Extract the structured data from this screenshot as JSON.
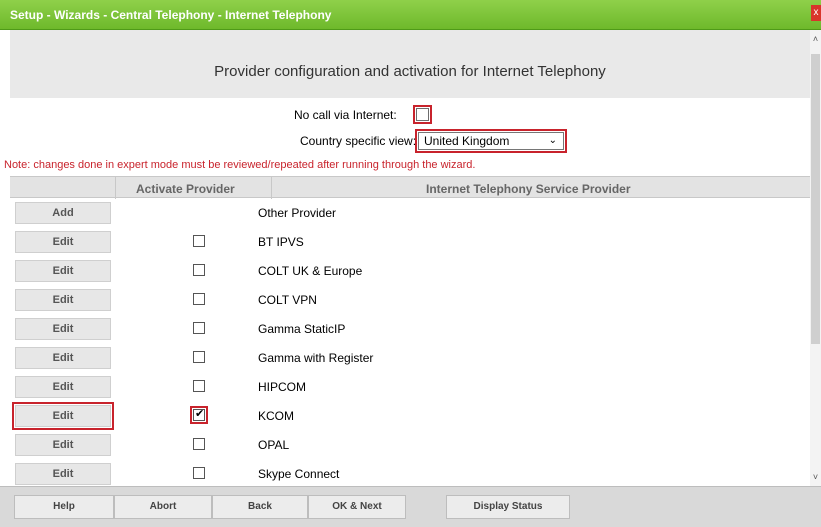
{
  "window": {
    "title": "Setup - Wizards - Central Telephony - Internet Telephony",
    "close_glyph": "x"
  },
  "header": {
    "title": "Provider configuration and activation for Internet Telephony"
  },
  "form": {
    "no_call_label": "No call via Internet:",
    "no_call_checked": false,
    "country_label": "Country specific view:",
    "country_value": "United Kingdom"
  },
  "note": "Note: changes done in expert mode must be reviewed/repeated after running through the wizard.",
  "table": {
    "headers": [
      "Activate Provider",
      "Internet Telephony Service Provider"
    ],
    "rows": [
      {
        "button": "Add",
        "has_checkbox": false,
        "checked": false,
        "name": "Other Provider"
      },
      {
        "button": "Edit",
        "has_checkbox": true,
        "checked": false,
        "name": "BT IPVS"
      },
      {
        "button": "Edit",
        "has_checkbox": true,
        "checked": false,
        "name": "COLT UK & Europe"
      },
      {
        "button": "Edit",
        "has_checkbox": true,
        "checked": false,
        "name": "COLT VPN"
      },
      {
        "button": "Edit",
        "has_checkbox": true,
        "checked": false,
        "name": "Gamma StaticIP"
      },
      {
        "button": "Edit",
        "has_checkbox": true,
        "checked": false,
        "name": "Gamma with Register"
      },
      {
        "button": "Edit",
        "has_checkbox": true,
        "checked": false,
        "name": "HIPCOM"
      },
      {
        "button": "Edit",
        "has_checkbox": true,
        "checked": true,
        "name": "KCOM"
      },
      {
        "button": "Edit",
        "has_checkbox": true,
        "checked": false,
        "name": "OPAL"
      },
      {
        "button": "Edit",
        "has_checkbox": true,
        "checked": false,
        "name": "Skype Connect"
      }
    ]
  },
  "footer": {
    "buttons": [
      "Help",
      "Abort",
      "Back",
      "OK & Next",
      "Display Status"
    ]
  },
  "colors": {
    "titlebar": "#6eb92b",
    "highlight": "#c8232c",
    "note": "#c8232c"
  }
}
